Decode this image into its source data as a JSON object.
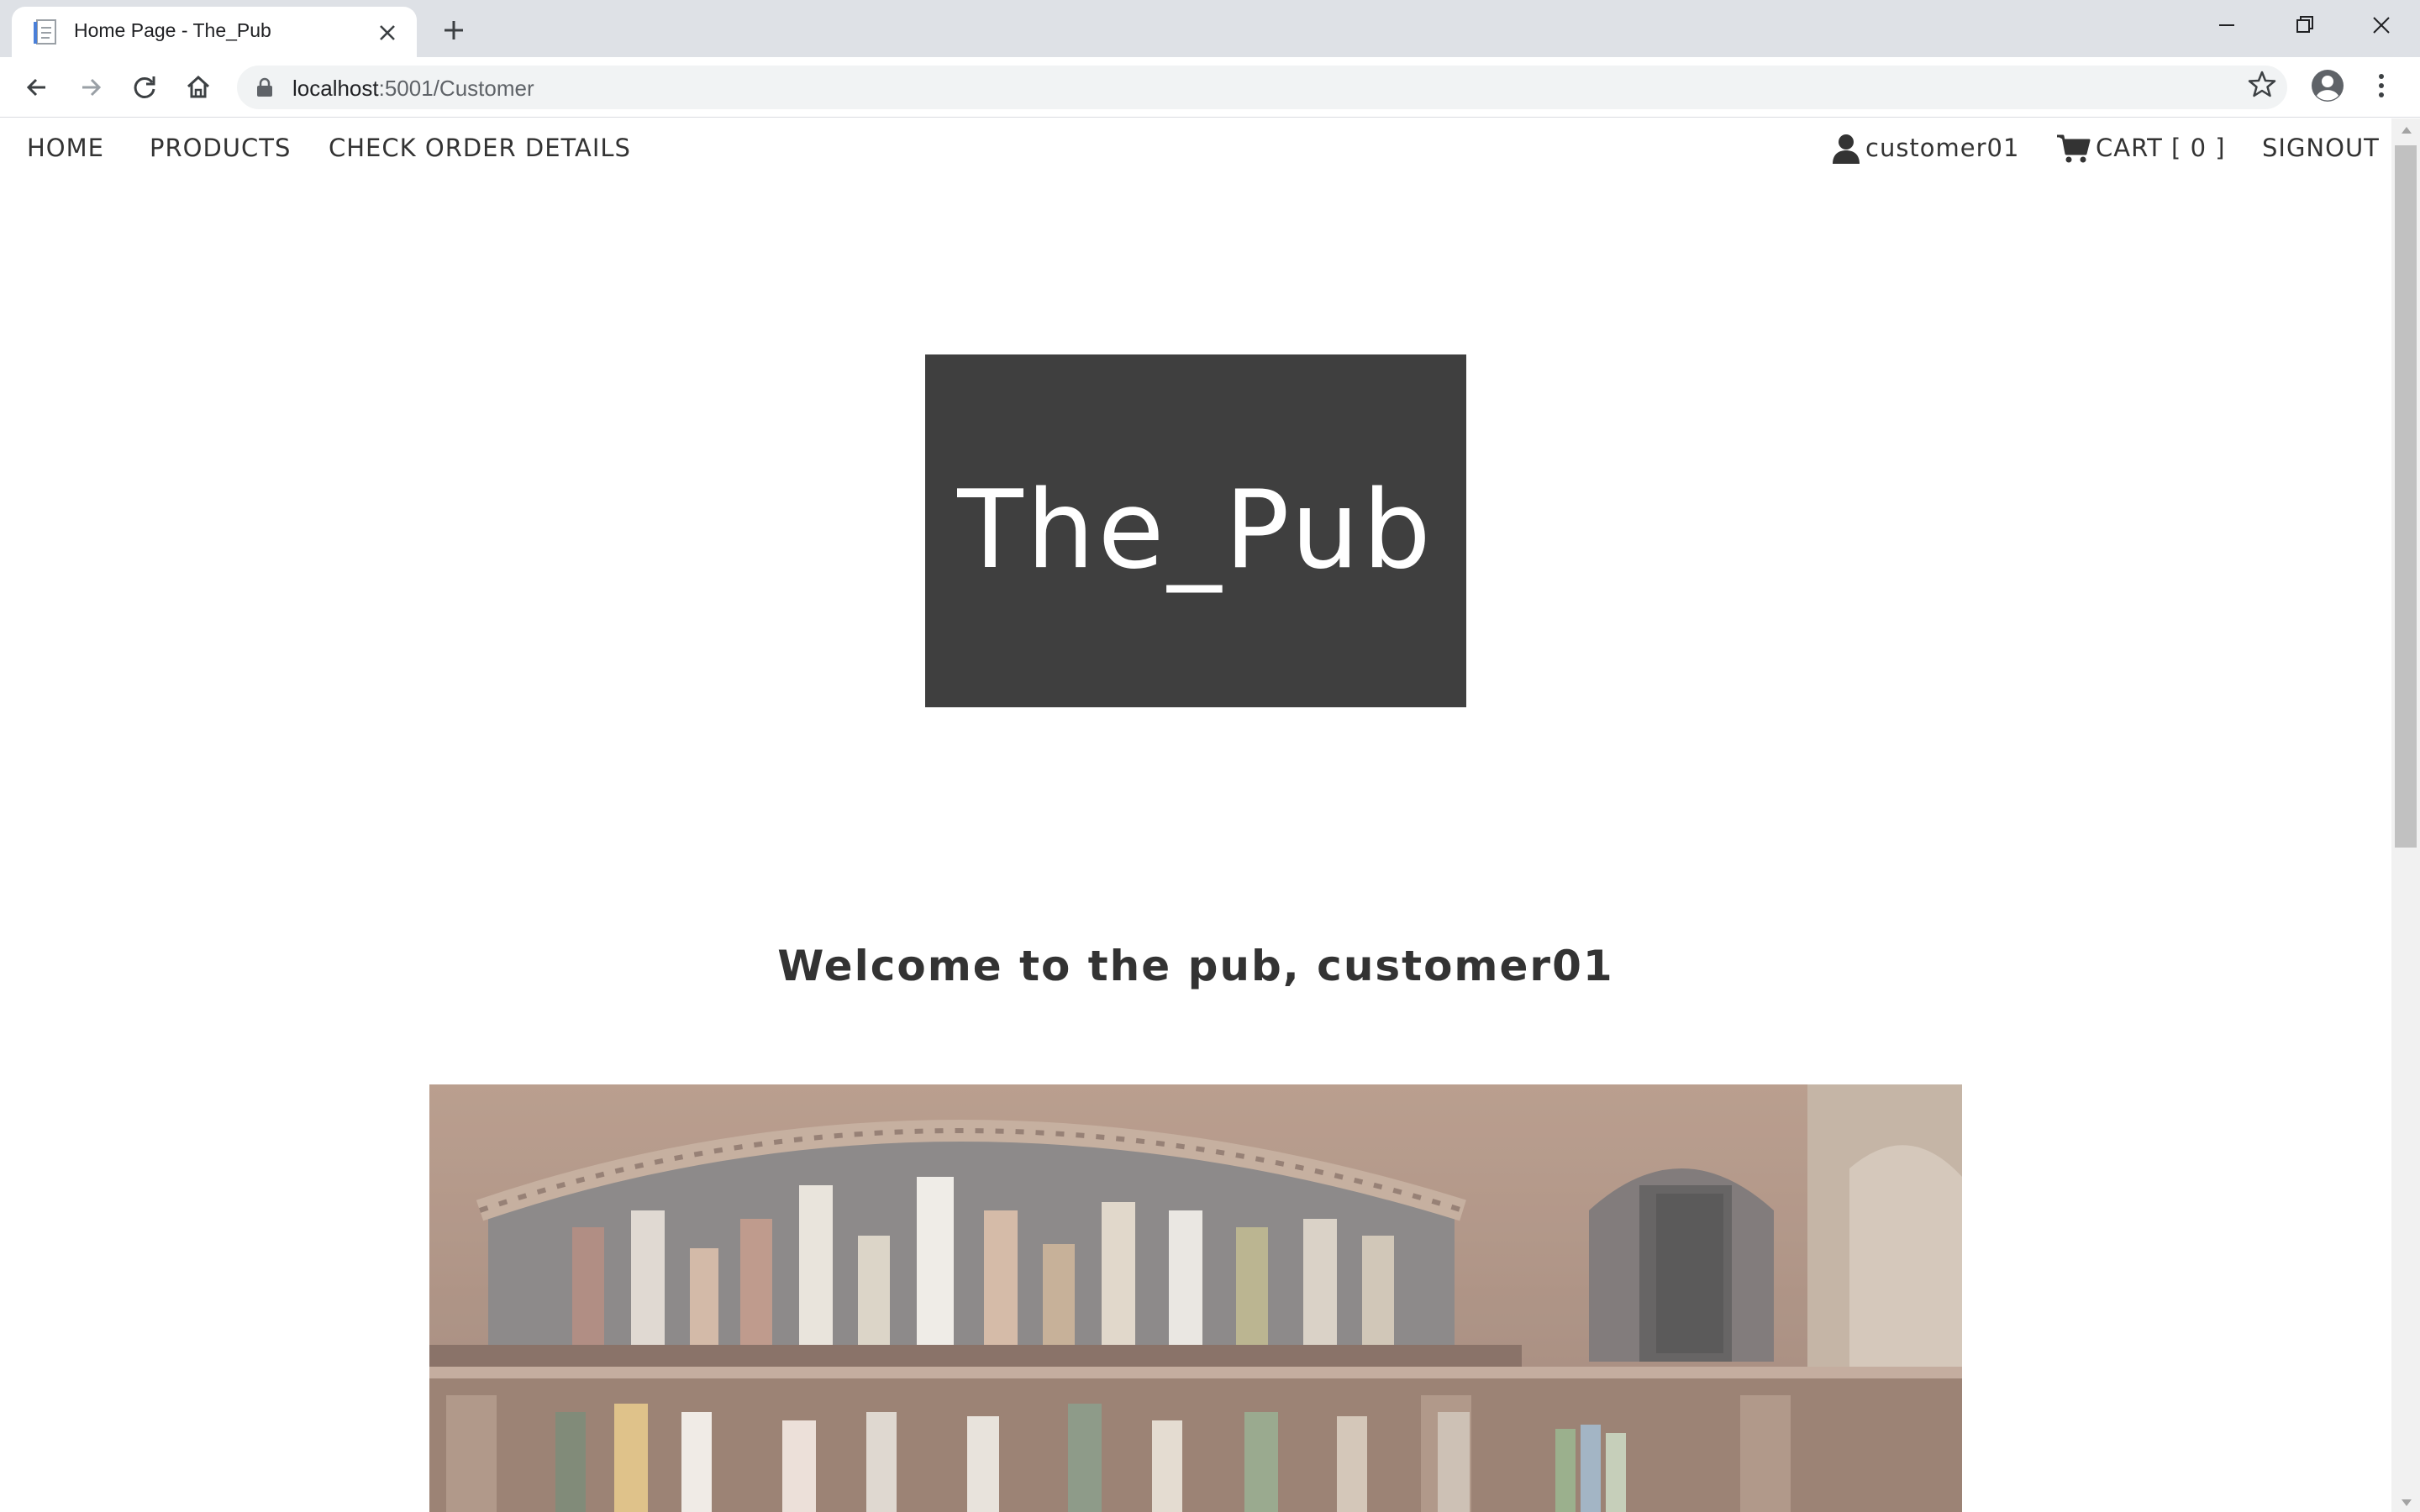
{
  "browser": {
    "tab_title": "Home Page - The_Pub",
    "url_host": "localhost",
    "url_path": ":5001/Customer"
  },
  "nav": {
    "home": "HOME",
    "products": "PRODUCTS",
    "check_order_details": "CHECK ORDER DETAILS",
    "username": "customer01",
    "cart": "CART [ 0 ]",
    "signout": "SIGNOUT"
  },
  "logo": {
    "text": "The_Pub"
  },
  "welcome": "Welcome to the pub, customer01",
  "colors": {
    "logo_bg": "#3f3f3f",
    "text": "#333333",
    "tabbar": "#dee1e6"
  }
}
